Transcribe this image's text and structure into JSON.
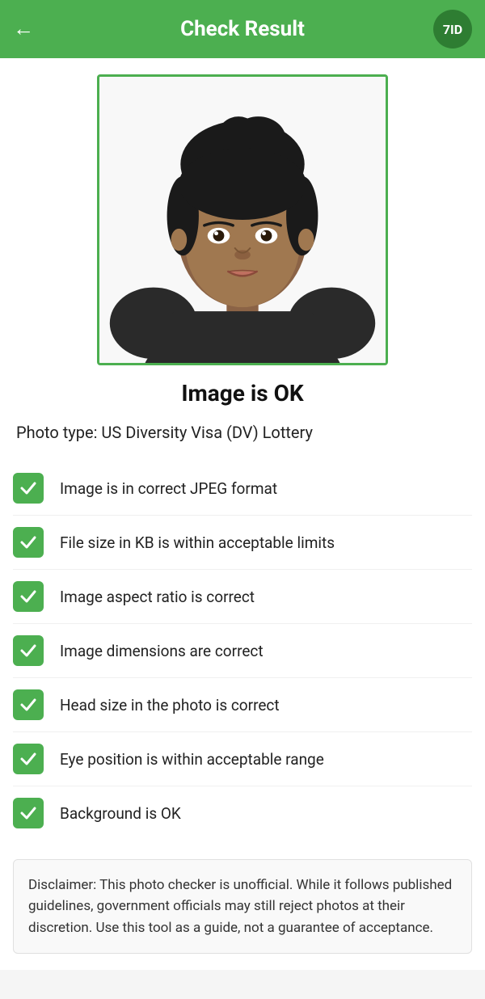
{
  "header": {
    "back_icon": "←",
    "title": "Check Result",
    "logo_text": "7ID"
  },
  "image_status": "Image is OK",
  "photo_type_label": "Photo type: US Diversity Visa (DV) Lottery",
  "check_items": [
    {
      "id": "jpeg",
      "label": "Image is in correct JPEG format"
    },
    {
      "id": "filesize",
      "label": "File size in KB is within acceptable limits"
    },
    {
      "id": "aspect",
      "label": "Image aspect ratio is correct"
    },
    {
      "id": "dimensions",
      "label": "Image dimensions are correct"
    },
    {
      "id": "headsize",
      "label": "Head size in the photo is correct"
    },
    {
      "id": "eyepos",
      "label": "Eye position is within acceptable range"
    },
    {
      "id": "background",
      "label": "Background is OK"
    }
  ],
  "disclaimer": "Disclaimer: This photo checker is unofficial. While it follows published guidelines, government officials may still reject photos at their discretion. Use this tool as a guide, not a guarantee of acceptance.",
  "colors": {
    "green": "#4CAF50",
    "dark_green": "#2e7d32"
  }
}
